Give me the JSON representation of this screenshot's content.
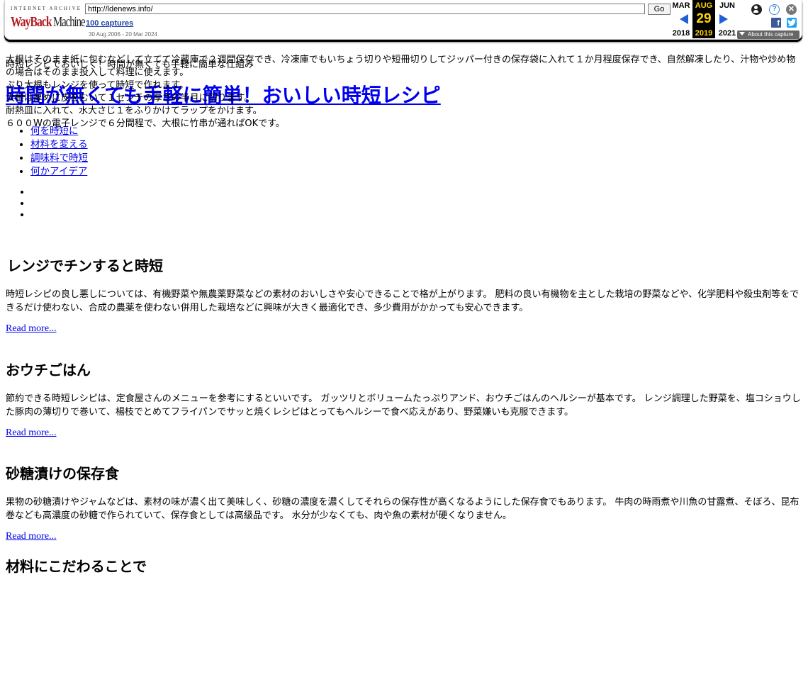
{
  "toolbar": {
    "logo_top": "INTERNET ARCHIVE",
    "logo_way": "WayBack",
    "logo_machine": "Machine",
    "url": "http://ldenews.info/",
    "go_label": "Go",
    "captures": "100 captures",
    "range": "30 Aug 2006 - 20 Mar 2024",
    "calendar": {
      "prev": {
        "month": "MAR",
        "year": "2018"
      },
      "current": {
        "month": "AUG",
        "day": "29",
        "year": "2019"
      },
      "next": {
        "month": "JUN",
        "year": "2021"
      }
    },
    "about_label": "About this capture",
    "facebook_glyph": "f",
    "help_glyph": "?",
    "close_glyph": "✕",
    "colors": {
      "accent": "#1f5fd6",
      "current_bg": "#000000",
      "current_fg": "#ffd700"
    }
  },
  "site": {
    "tagline": "時短レシピでおいしく！時間が無くても手軽に簡単な仕組み",
    "title": "時間が無くても手軽に簡単！おいしい時短レシピ",
    "nav": [
      {
        "label": "何を時短に"
      },
      {
        "label": "材料を変える"
      },
      {
        "label": "調味料で時短"
      },
      {
        "label": "何かアイデア"
      }
    ]
  },
  "articles": [
    {
      "title": "レンジでチンすると時短",
      "body": "時短レシピの良し悪しについては、有機野菜や無農薬野菜などの素材のおいしさや安心できることで格が上がります。 肥料の良い有機物を主とした栽培の野菜などや、化学肥料や殺虫剤等をできるだけ使わない、合成の農薬を使わない併用した栽培などに興味が大きく最適化でき、多少費用がかかっても安心できます。",
      "more": "Read more..."
    },
    {
      "title": "おウチごはん",
      "body": "節約できる時短レシピは、定食屋さんのメニューを参考にするといいです。 ガッツリとボリュームたっぷりアンド、おウチごはんのヘルシーが基本です。 レンジ調理した野菜を、塩コショウした豚肉の薄切りで巻いて、楊枝でとめてフライパンでサッと焼くレシピはとってもヘルシーで食べ応えがあり、野菜嫌いも克服できます。",
      "more": "Read more..."
    },
    {
      "title": "砂糖漬けの保存食",
      "body": "果物の砂糖漬けやジャムなどは、素材の味が濃く出て美味しく、砂糖の濃度を濃くしてそれらの保存性が高くなるようにした保存食でもあります。 牛肉の時雨煮や川魚の甘露煮、そぼろ、昆布巻なども高濃度の砂糖で作られていて、保存食としては高級品です。 水分が少なくても、肉や魚の素材が硬くなりません。",
      "more": "Read more..."
    },
    {
      "title": "材料にこだわることで",
      "lines": [
        "大根はそのまま紙に包むなどして立てて冷蔵庫で２週間保存でき、冷凍庫でもいちょう切りや短冊切りしてジッパー付きの保存袋に入れて１か月程度保存でき、自然解凍したり、汁物や炒め物の場合はそのまま投入して料理に使えます。",
        "ぶり大根もレンジを使って時短で作れます。",
        "大根は厚めに皮をむいて１センチの厚さの半月に切ります。",
        "耐熱皿に入れて、水大さじ１をふりかけてラップをかけます。",
        "６００Wの電子レンジで６分間程で、大根に竹串が通ればOKです。"
      ]
    }
  ]
}
